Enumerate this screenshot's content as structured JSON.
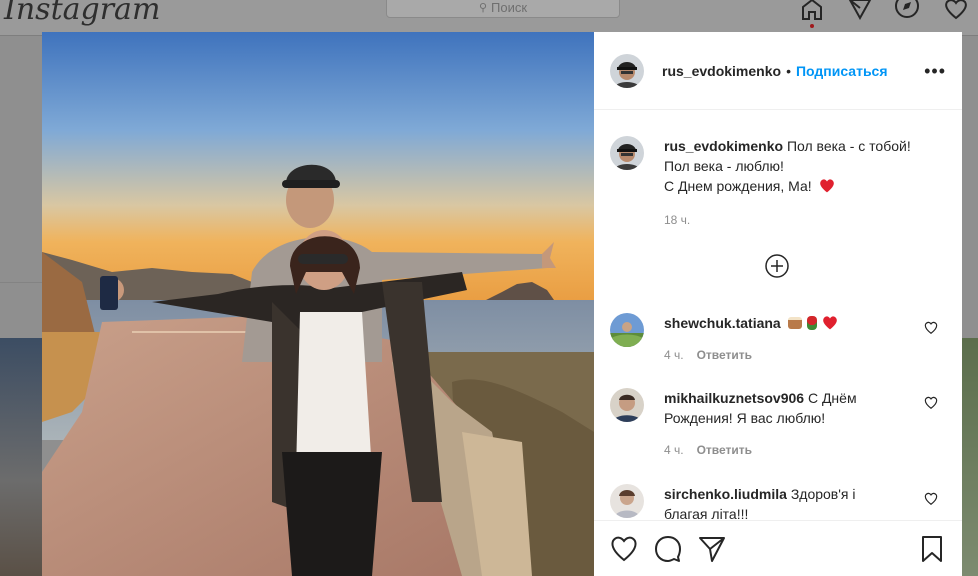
{
  "app": {
    "logo_text": "Instagram"
  },
  "topbar": {
    "search_placeholder": "Поиск"
  },
  "post": {
    "username": "rus_evdokimenko",
    "follow_label": "Подписаться",
    "separator": "•",
    "more_label": "•••",
    "caption": {
      "username": "rus_evdokimenko",
      "line1": "Пол века - с тобой!",
      "line2": "Пол века - люблю!",
      "line3": "С Днем рождения, Ма!",
      "time": "18 ч."
    }
  },
  "comments": [
    {
      "username": "shewchuk.tatiana",
      "text": "",
      "time": "4 ч.",
      "reply_label": "Ответить"
    },
    {
      "username": "mikhailkuznetsov906",
      "text": "С Днём Рождения! Я вас люблю!",
      "time": "4 ч.",
      "reply_label": "Ответить"
    },
    {
      "username": "sirchenko.liudmila",
      "text": "Здоров'я і благая літа!!!",
      "time": "",
      "reply_label": ""
    }
  ],
  "colors": {
    "accent": "#0095f6",
    "heart": "#ed4956",
    "muted": "#8e8e8e"
  }
}
